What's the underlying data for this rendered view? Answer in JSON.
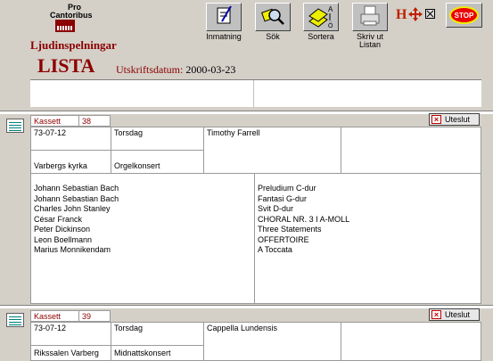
{
  "app": {
    "logo_top": "Pro",
    "logo_name": "Cantoribus",
    "subtitle": "Ljudinspelningar",
    "title": "LISTA",
    "date_label": "Utskriftsdatum:",
    "date_value": "2000-03-23"
  },
  "toolbar": {
    "items": [
      {
        "label": "Inmatning",
        "icon": "pen-edit-icon"
      },
      {
        "label": "Sök",
        "icon": "magnifier-search-icon"
      },
      {
        "label": "Sortera",
        "icon": "sort-az-icon"
      },
      {
        "label": "Skriv ut\nListan",
        "icon": "printer-icon"
      }
    ],
    "extra_icons": [
      "h-icon",
      "arrows-move-icon",
      "close-box-icon"
    ],
    "stop_label": "STOP"
  },
  "records": [
    {
      "type_label": "Kassett",
      "number": "38",
      "date": "73-07-12",
      "day": "Torsdag",
      "performer": "Timothy Farrell",
      "place": "Varbergs kyrka",
      "event": "Orgelkonsert",
      "exclude_label": "Uteslut",
      "composers": [
        "Johann Sebastian  Bach",
        "Johann Sebastian  Bach",
        "Charles John Stanley",
        "César Franck",
        "Peter Dickinson",
        "Leon Boellmann",
        "Marius Monnikendam"
      ],
      "works": [
        "Preludium C-dur",
        "Fantasi G-dur",
        "Svit D-dur",
        "CHORAL NR. 3  I A-MOLL",
        "Three Statements",
        "OFFERTOIRE",
        "A Toccata"
      ]
    },
    {
      "type_label": "Kassett",
      "number": "39",
      "date": "73-07-12",
      "day": "Torsdag",
      "performer": "Cappella Lundensis",
      "place": "Rikssalen Varberg",
      "event": "Midnattskonsert",
      "exclude_label": "Uteslut",
      "composers": [],
      "works": []
    }
  ],
  "colors": {
    "accent_red": "#8b0000",
    "window_gray": "#d4d0c8"
  }
}
